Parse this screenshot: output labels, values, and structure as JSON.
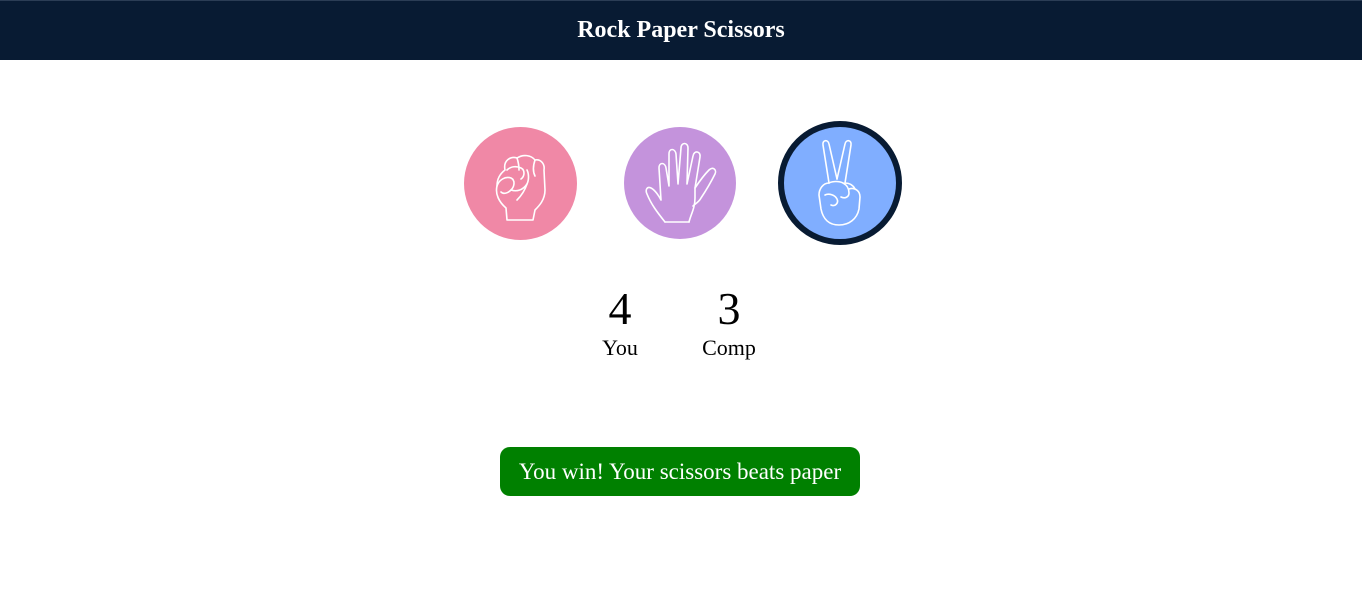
{
  "header": {
    "title": "Rock Paper Scissors"
  },
  "choices": [
    {
      "name": "rock",
      "icon": "fist-icon",
      "color": "#f088a6",
      "selected": false
    },
    {
      "name": "paper",
      "icon": "open-hand-icon",
      "color": "#c493dc",
      "selected": false
    },
    {
      "name": "scissors",
      "icon": "peace-sign-icon",
      "color": "#80aeff",
      "selected": true
    }
  ],
  "scores": {
    "user": {
      "value": "4",
      "label": "You"
    },
    "computer": {
      "value": "3",
      "label": "Comp"
    }
  },
  "result": {
    "message": "You win! Your scissors beats paper",
    "color": "#008000"
  },
  "colors": {
    "navbar": "#081b33",
    "selected_border": "#081b33"
  }
}
